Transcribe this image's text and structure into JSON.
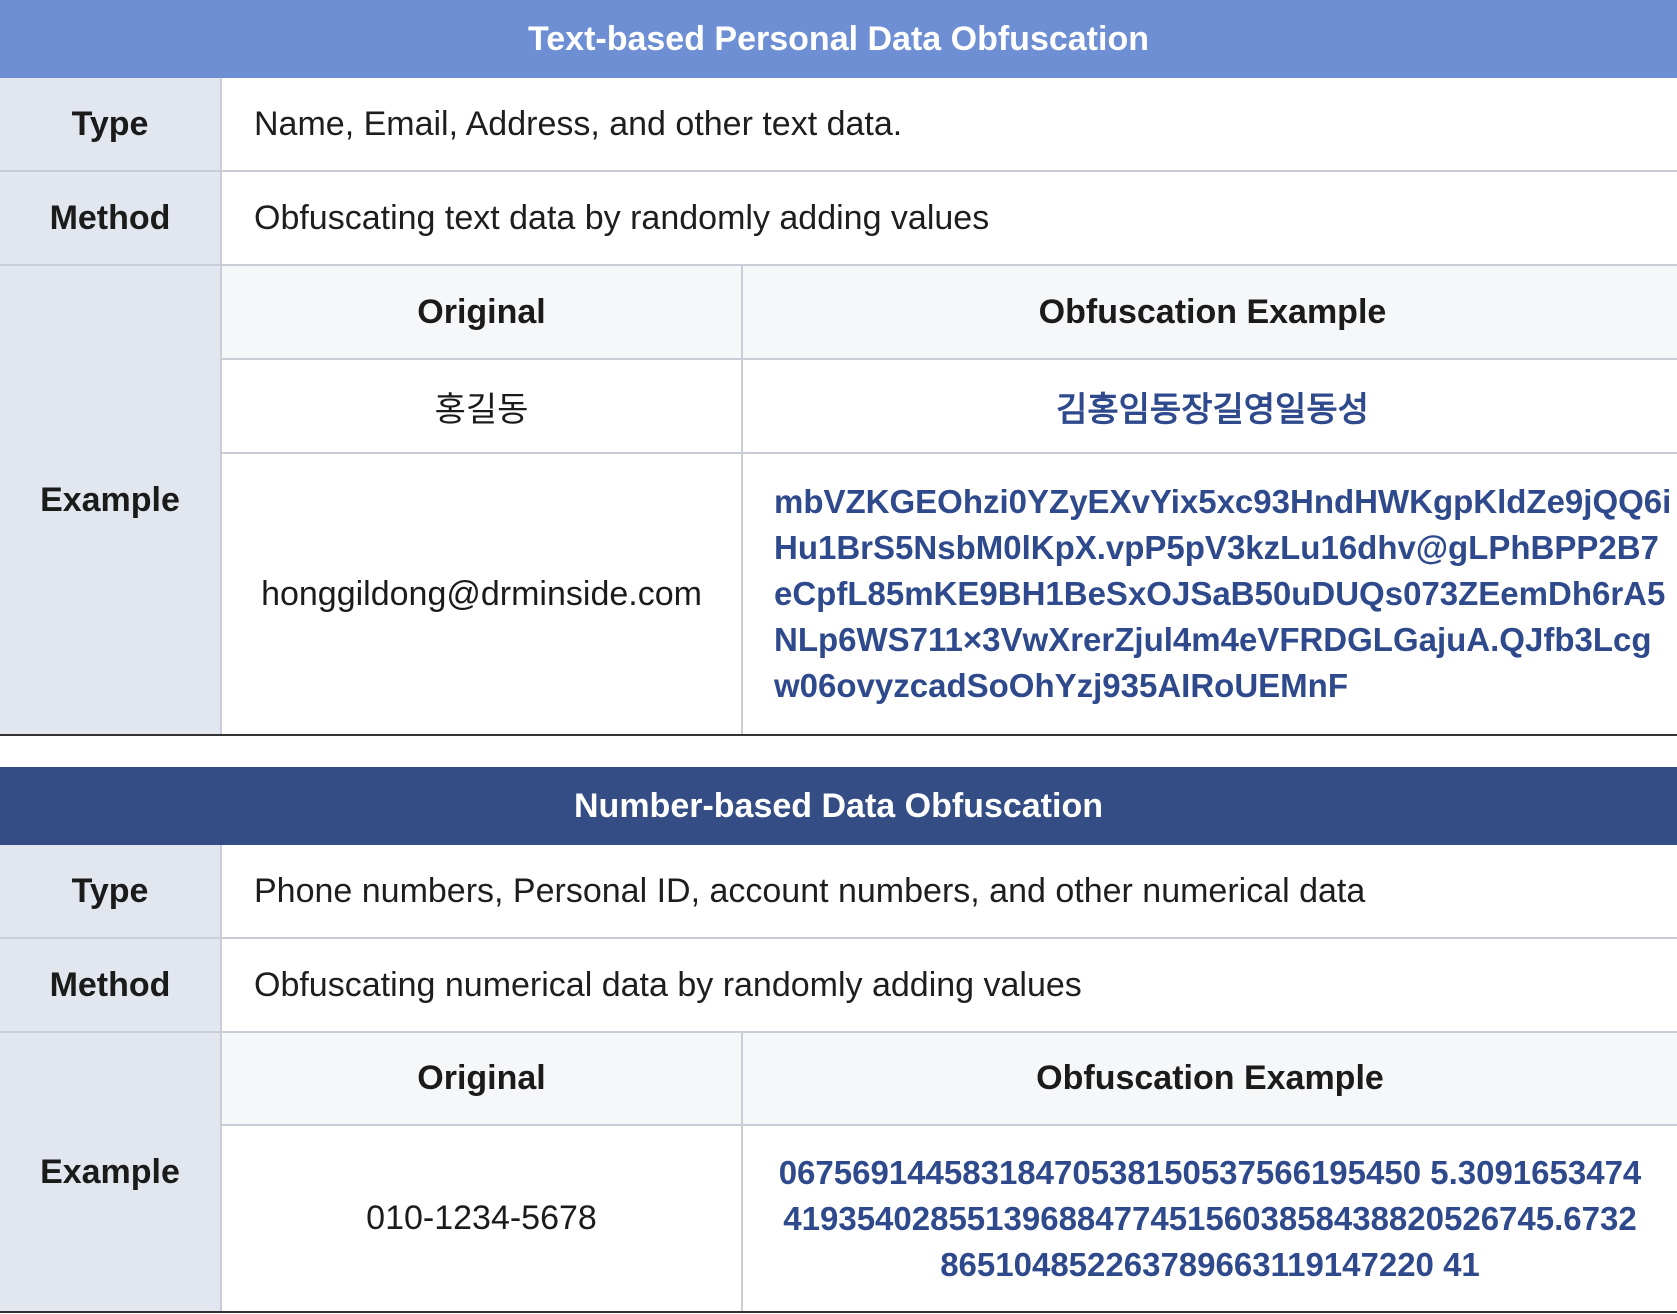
{
  "text_section": {
    "title": "Text-based Personal Data Obfuscation",
    "type_label": "Type",
    "type_value": "Name, Email, Address, and other text data.",
    "method_label": "Method",
    "method_value": "Obfuscating text data by randomly adding values",
    "example_label": "Example",
    "col_original": "Original",
    "col_obfuscation": "Obfuscation Example",
    "rows": [
      {
        "original": "홍길동",
        "obfuscated": "김홍임동장길영일동성"
      },
      {
        "original": "honggildong@drminside.com",
        "obfuscated": "mbVZKGEOhzi0YZyEXvYix5xc93HndHWKgpKldZe9jQQ6iHu1BrS5NsbM0lKpX.vpP5pV3kzLu16dhv@gLPhBPP2B7eCpfL85mKE9BH1BeSxOJSaB50uDUQs073ZEemDh6rA5NLp6WS711×3VwXrerZjul4m4eVFRDGLGajuA.QJfb3Lcgw06ovyzcadSoOhYzj935AIRoUEMnF"
      }
    ]
  },
  "number_section": {
    "title": "Number-based Data Obfuscation",
    "type_label": "Type",
    "type_value": "Phone numbers, Personal ID, account numbers, and other numerical data",
    "method_label": "Method",
    "method_value": "Obfuscating numerical data by randomly adding values",
    "example_label": "Example",
    "col_original": "Original",
    "col_obfuscation": "Obfuscation Example",
    "rows": [
      {
        "original": "010-1234-5678",
        "obfuscated": "06756914458318470538150537566195450 5.3091653474419354028551396884774515603858438820526745.6732865104852263789663119147220 41"
      }
    ]
  }
}
